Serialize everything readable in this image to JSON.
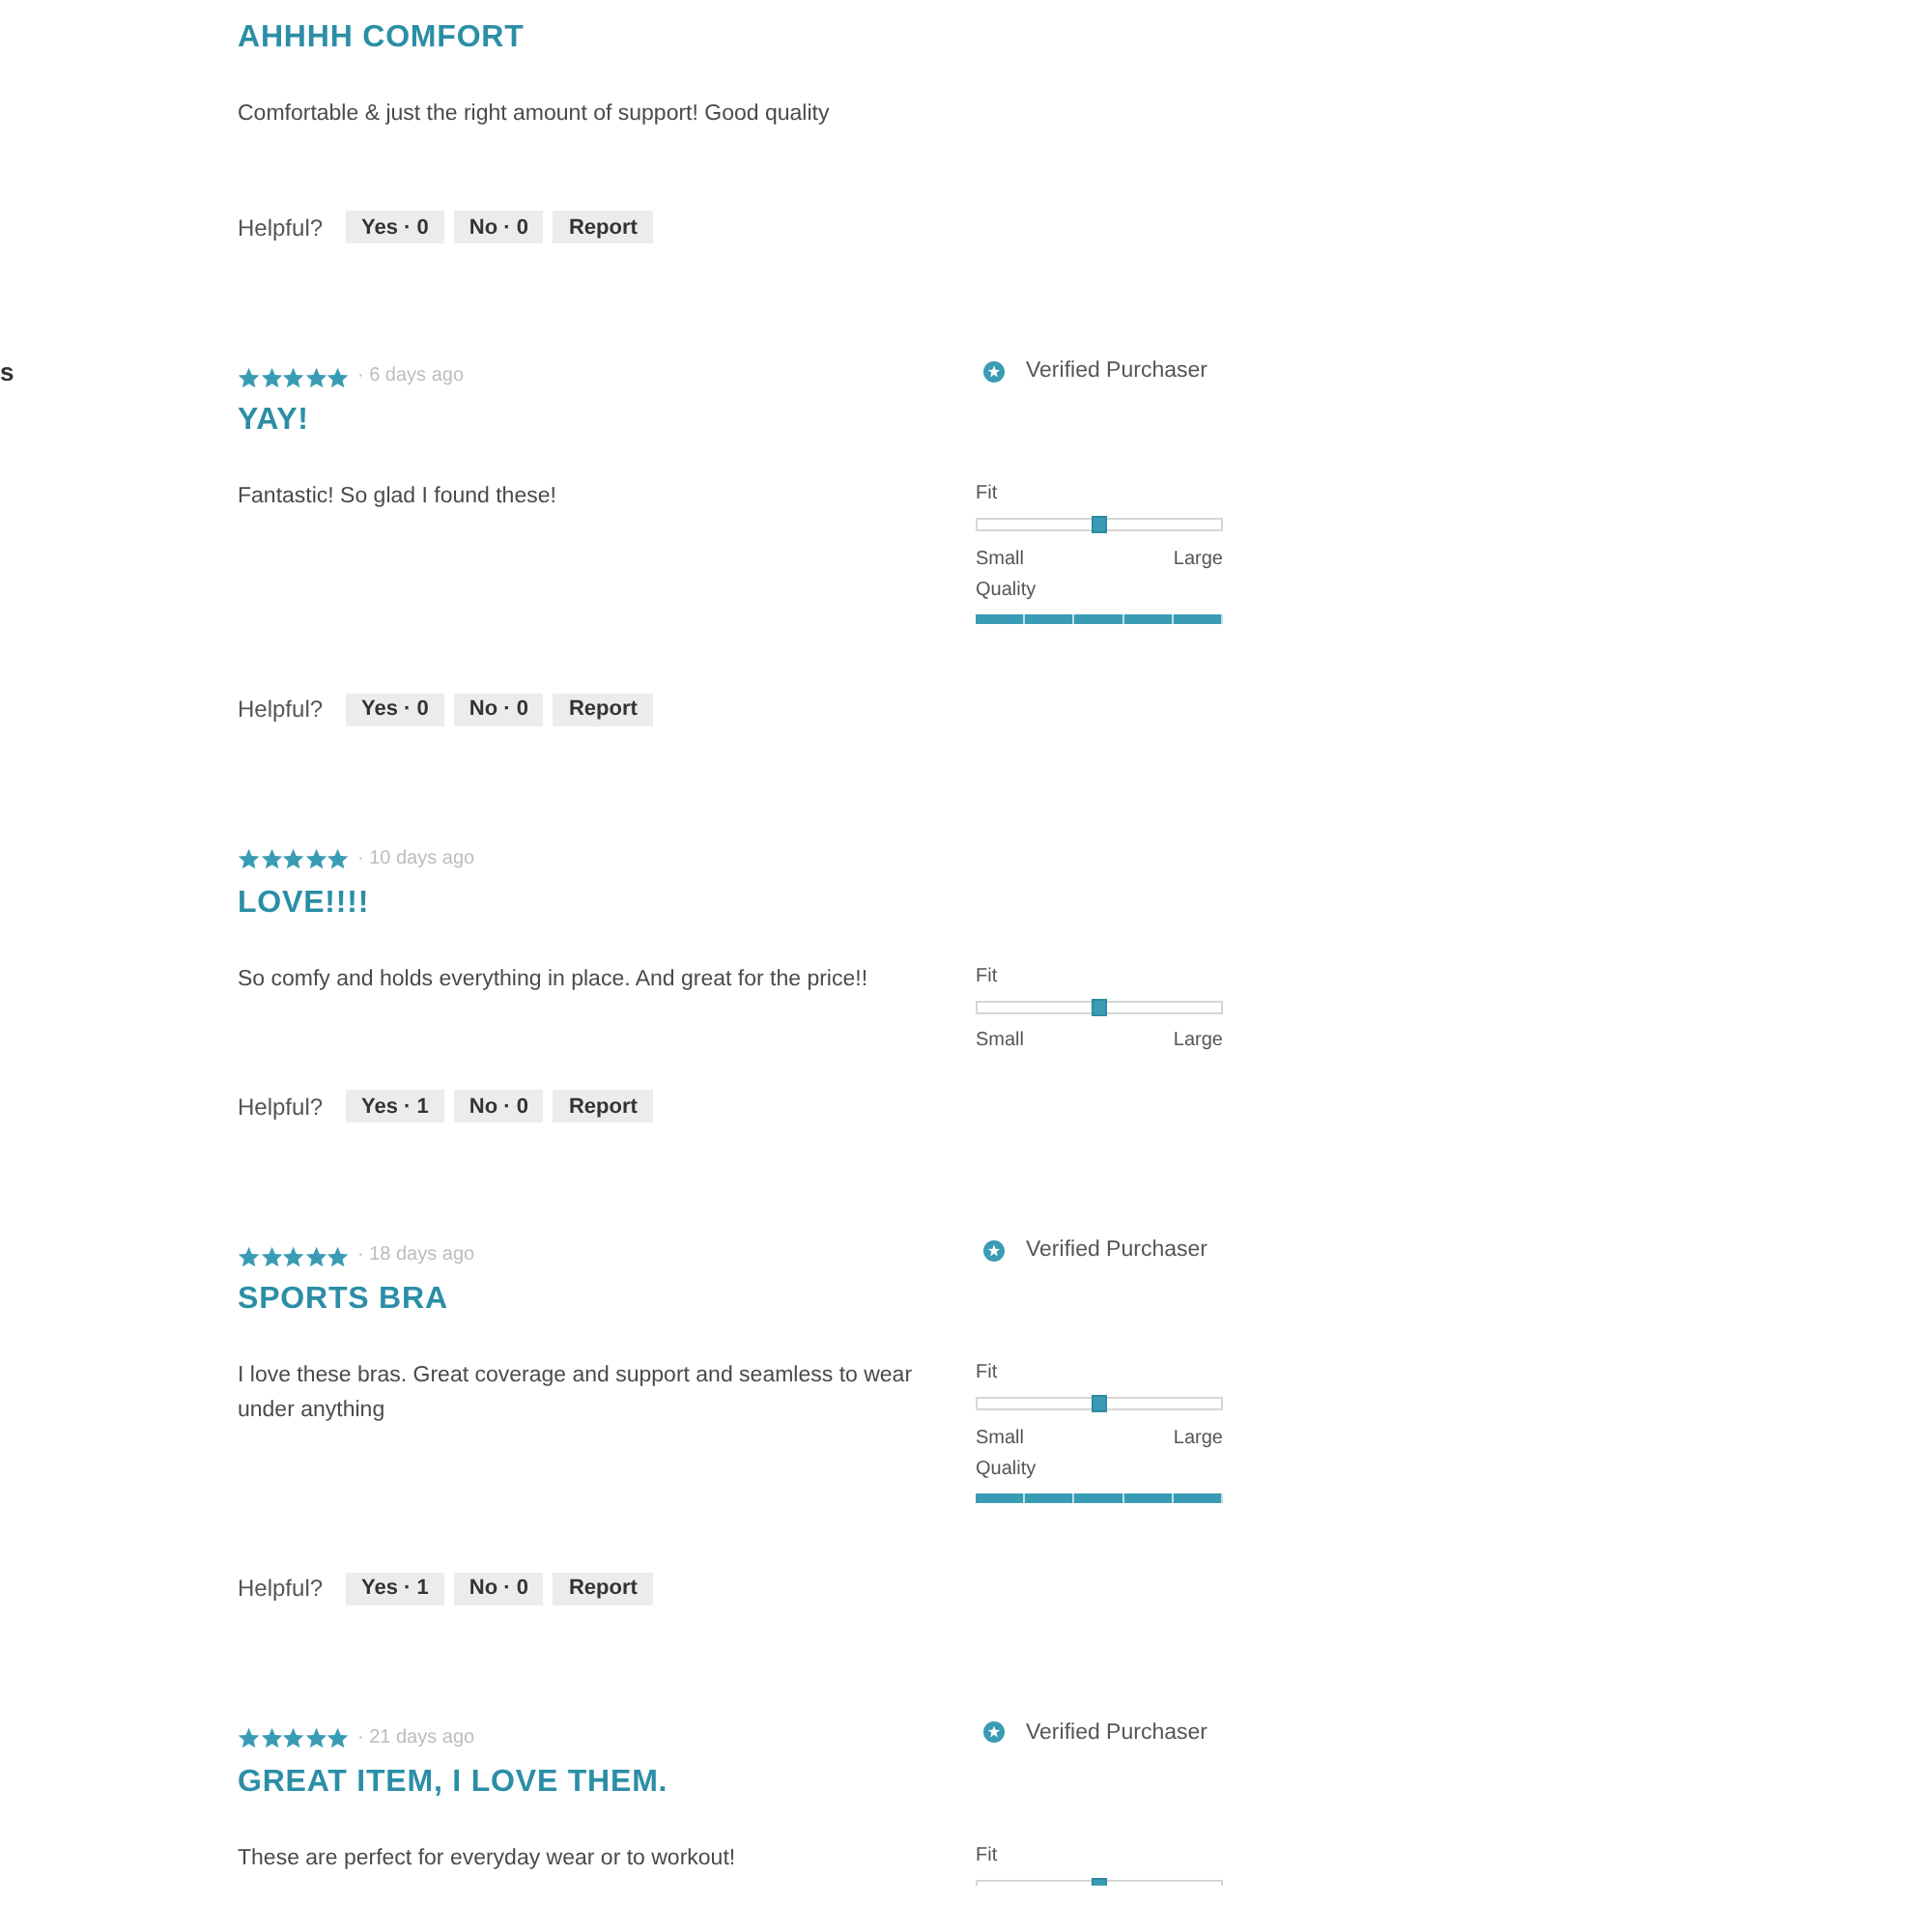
{
  "sidebar": {
    "text_fragment": "s"
  },
  "reviews": [
    {
      "title": "AHHHH COMFORT",
      "body": "Comfortable & just the right amount of support! Good quality",
      "helpful": {
        "label": "Helpful?",
        "buttons": [
          "Yes · 0",
          "No · 0",
          "Report"
        ]
      }
    },
    {
      "stars": 5,
      "date": "· 6 days ago",
      "title": "YAY!",
      "verified": "Verified Purchaser",
      "body": "Fantastic! So glad I found these!",
      "ratings": [
        {
          "kind": "slider",
          "label": "Fit",
          "level": 0.5,
          "min_label": "Small",
          "max_label": "Large"
        },
        {
          "kind": "segments",
          "label": "Quality",
          "level": 1
        }
      ],
      "helpful": {
        "label": "Helpful?",
        "buttons": [
          "Yes · 0",
          "No · 0",
          "Report"
        ]
      }
    },
    {
      "stars": 5,
      "date": "· 10 days ago",
      "title": "LOVE!!!!",
      "body": "So comfy and holds everything in place. And great for the price!!",
      "ratings": [
        {
          "kind": "slider",
          "label": "Fit",
          "level": 0.5,
          "min_label": "Small",
          "max_label": "Large"
        }
      ],
      "helpful": {
        "label": "Helpful?",
        "buttons": [
          "Yes · 1",
          "No · 0",
          "Report"
        ]
      }
    },
    {
      "stars": 5,
      "date": "· 18 days ago",
      "title": "SPORTS BRA",
      "verified": "Verified Purchaser",
      "body": "I love these bras. Great coverage and support and seamless to wear under anything",
      "ratings": [
        {
          "kind": "slider",
          "label": "Fit",
          "level": 0.5,
          "min_label": "Small",
          "max_label": "Large"
        },
        {
          "kind": "segments",
          "label": "Quality",
          "level": 1
        }
      ],
      "helpful": {
        "label": "Helpful?",
        "buttons": [
          "Yes · 1",
          "No · 0",
          "Report"
        ]
      }
    },
    {
      "stars": 5,
      "date": "· 21 days ago",
      "title": "GREAT ITEM, I LOVE THEM.",
      "verified": "Verified Purchaser",
      "body": "These are perfect for everyday wear or to workout!",
      "ratings": [
        {
          "kind": "slider",
          "label": "Fit",
          "level": 0.5
        }
      ]
    }
  ]
}
